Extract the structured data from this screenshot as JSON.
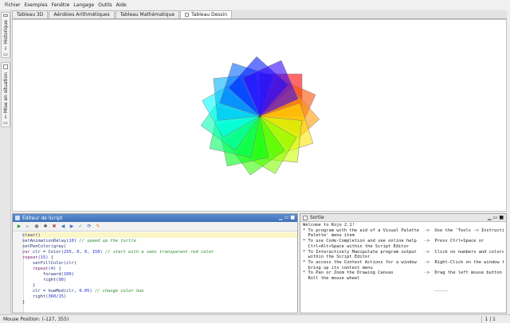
{
  "menu": [
    "Fichier",
    "Exemples",
    "Fenêtre",
    "Langage",
    "Outils",
    "Aide"
  ],
  "side_tabs": [
    {
      "label": "Historique",
      "pin": "⇩"
    },
    {
      "label": "Mise en situation",
      "pin": "⇩"
    }
  ],
  "tabs": [
    "Tableau 3D",
    "Aérobies Arithmétiques",
    "Tableau Mathématique",
    "Tableau Dessin"
  ],
  "active_tab": 3,
  "drawing": {
    "petal_count": 15,
    "turn_degrees": 24,
    "square_side": 100,
    "start_color": [
      255,
      0,
      0,
      150
    ],
    "hue_step": 0.05
  },
  "editor": {
    "title": "Éditeur de Script",
    "code_lines": [
      {
        "n": "1",
        "text": "clear()"
      },
      {
        "n": "2",
        "text": "setAnimationDelay(10) // speed up the turtle"
      },
      {
        "n": "3",
        "text": "setPenColor(gray)"
      },
      {
        "n": "4",
        "text": "var clr = Color(255, 0, 0, 150) // start with a semi transparent red color"
      },
      {
        "n": "5",
        "text": "repeat(15) {"
      },
      {
        "n": "6",
        "text": "    setFillColor(clr)"
      },
      {
        "n": "7",
        "text": "    repeat(4) {"
      },
      {
        "n": "8",
        "text": "        forward(100)"
      },
      {
        "n": "9",
        "text": "        right(90)"
      },
      {
        "n": "10",
        "text": "    }"
      },
      {
        "n": "11",
        "text": "    clr = hueMod(clr, 0.05) // change color hue"
      },
      {
        "n": "12",
        "text": "    right(360/15)"
      },
      {
        "n": "13",
        "text": "}"
      },
      {
        "n": "14",
        "text": ""
      }
    ]
  },
  "output_panel": {
    "title": "Sortie",
    "lines": [
      "Welcome to Kojo 2.1!",
      "* To program with the aid of a Visual Palette  ->  Use the 'Tools -> Instruction",
      "  Palette' menu item",
      "* To use Code-Completion and see online help   ->  Press Ctrl+Space or",
      "  Ctrl+Alt+Space within the Script Editor",
      "* To Interactively Manipulate program output   ->  Click on numbers and colors",
      "  within the Script Editor",
      "* To access the Context Actions for a window   ->  Right-Click on the window to",
      "  bring up its context menu",
      "* To Pan or Zoom the Drawing Canvas            ->  Drag the left mouse button or",
      "  Roll the mouse wheel",
      "",
      "                                                   _____"
    ]
  },
  "status": {
    "mouse_position": "Mouse Position: (-127, 355)",
    "cursor": "1 | 1"
  },
  "colors": {
    "editor_header": "#4a7dc3",
    "highlight_line": "#fbf6c6",
    "pen_gray": "#808080"
  }
}
